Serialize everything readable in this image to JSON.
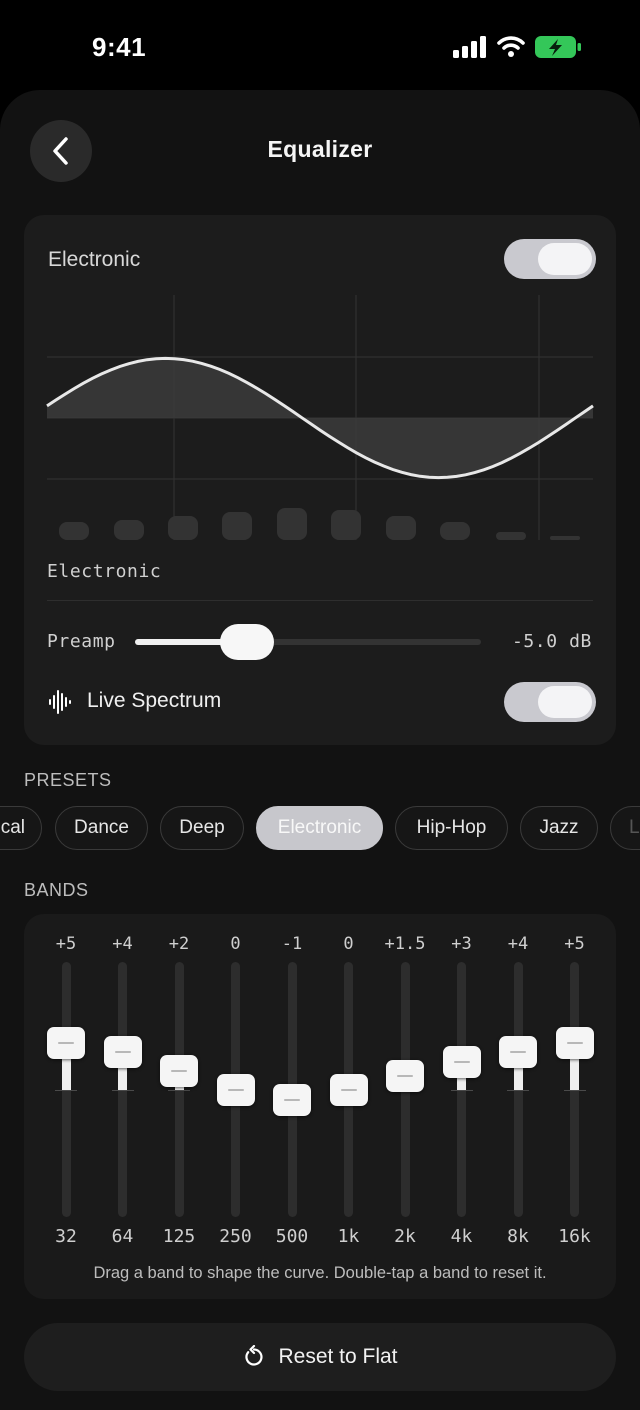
{
  "status_bar": {
    "time": "9:41"
  },
  "header": {
    "title": "Equalizer"
  },
  "card": {
    "label": "Electronic",
    "enabled": true,
    "curve_name": "Electronic",
    "preamp": {
      "label": "Preamp",
      "value_label": "-5.0 dB",
      "level_fraction": 0.28
    },
    "live_spectrum": {
      "label": "Live Spectrum",
      "enabled": true
    }
  },
  "presets": {
    "label": "PRESETS",
    "items": [
      "Classical",
      "Dance",
      "Deep",
      "Electronic",
      "Hip-Hop",
      "Jazz",
      "Latin"
    ],
    "selected": "Electronic"
  },
  "bands": {
    "label": "BANDS",
    "values": [
      {
        "gain_label": "+5",
        "freq": "32",
        "gain": 5
      },
      {
        "gain_label": "+4",
        "freq": "64",
        "gain": 4
      },
      {
        "gain_label": "+2",
        "freq": "125",
        "gain": 2
      },
      {
        "gain_label": "0",
        "freq": "250",
        "gain": 0
      },
      {
        "gain_label": "-1",
        "freq": "500",
        "gain": -1
      },
      {
        "gain_label": "0",
        "freq": "1k",
        "gain": 0
      },
      {
        "gain_label": "+1.5",
        "freq": "2k",
        "gain": 1.5
      },
      {
        "gain_label": "+3",
        "freq": "4k",
        "gain": 3
      },
      {
        "gain_label": "+4",
        "freq": "8k",
        "gain": 4
      },
      {
        "gain_label": "+5",
        "freq": "16k",
        "gain": 5
      }
    ],
    "hint": "Drag a band to shape the curve. Double-tap a band to reset it."
  },
  "reset_button": {
    "label": "Reset to Flat"
  },
  "colors": {
    "accent_active": "#c7c7cc",
    "background": "#000000",
    "card": "#1c1c1c",
    "battery": "#34c759"
  }
}
